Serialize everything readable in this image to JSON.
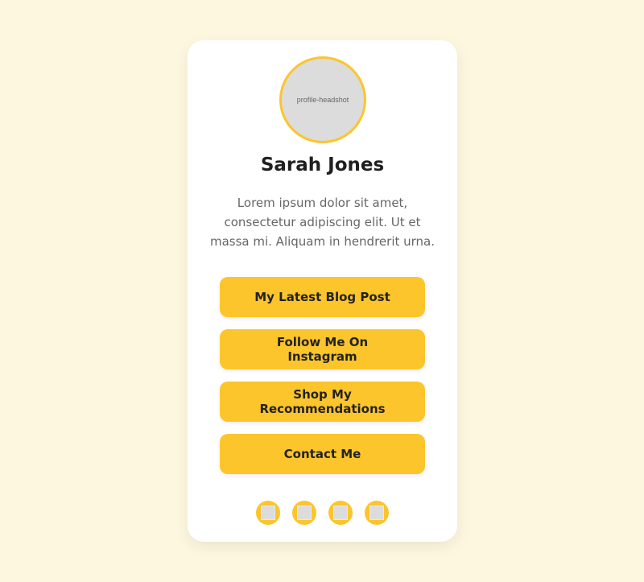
{
  "profile": {
    "avatar_alt": "profile-headshot",
    "name": "Sarah Jones",
    "bio": "Lorem ipsum dolor sit amet, consectetur adipiscing elit. Ut et massa mi. Aliquam in hendrerit urna."
  },
  "links": [
    {
      "label": "My Latest Blog Post"
    },
    {
      "label": "Follow Me On Instagram"
    },
    {
      "label": "Shop My Recommendations"
    },
    {
      "label": "Contact Me"
    }
  ],
  "socials": [
    {
      "icon": "social-icon-1"
    },
    {
      "icon": "social-icon-2"
    },
    {
      "icon": "social-icon-3"
    },
    {
      "icon": "social-icon-4"
    }
  ],
  "colors": {
    "background": "#fef7e0",
    "accent": "#fcc52c",
    "card": "#ffffff",
    "text": "#1f1f1f",
    "muted": "#666666"
  }
}
